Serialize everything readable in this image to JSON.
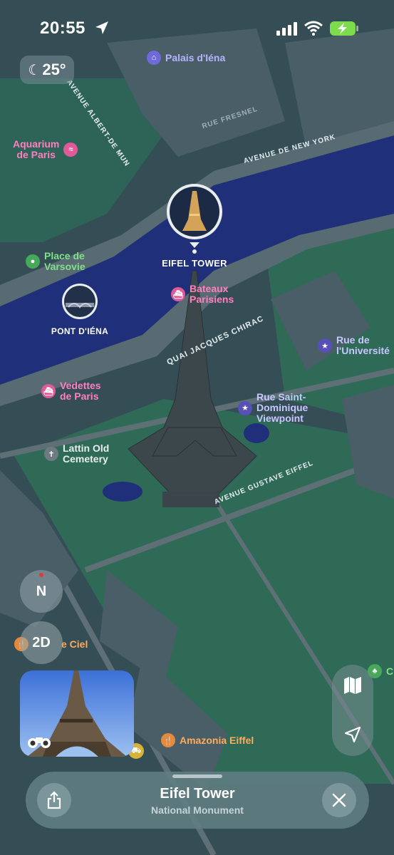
{
  "status_bar": {
    "time": "20:55",
    "location_icon": "location-arrow-icon",
    "signal_icon": "cellular-signal-icon",
    "wifi_icon": "wifi-icon",
    "battery_icon": "battery-charging-icon",
    "battery_color": "#7ddc4c"
  },
  "weather": {
    "temperature": "25°",
    "icon": "moon-stars-icon"
  },
  "streets": [
    {
      "label": "AVENUE ALBERT-DE MUN"
    },
    {
      "label": "AVENUE DE NEW YORK"
    },
    {
      "label": "RUE FRESNEL"
    },
    {
      "label": "QUAI JACQUES CHIRAC"
    },
    {
      "label": "AVENUE GUSTAVE EIFFEL"
    }
  ],
  "pois": {
    "palais": {
      "label": "Palais d'Iéna",
      "icon": "museum-icon"
    },
    "aquarium": {
      "label": "Aquarium de Paris",
      "line1": "Aquarium",
      "line2": "de Paris",
      "icon": "fish-icon"
    },
    "place_varsovie": {
      "line1": "Place de",
      "line2": "Varsovie",
      "icon": "park-icon"
    },
    "bateaux": {
      "line1": "Bateaux",
      "line2": "Parisiens",
      "icon": "ferry-icon"
    },
    "rue_universite": {
      "line1": "Rue de",
      "line2": "l'Université",
      "icon": "star-icon"
    },
    "vedettes": {
      "line1": "Vedettes",
      "line2": "de Paris",
      "icon": "ferry-icon"
    },
    "rue_saint_dominique": {
      "line1": "Rue Saint-",
      "line2": "Dominique",
      "line3": "Viewpoint",
      "icon": "star-icon"
    },
    "lattin": {
      "line1": "Lattin Old",
      "line2": "Cemetery",
      "icon": "cemetery-icon"
    },
    "ciel": {
      "label": "e Ciel",
      "icon": "restaurant-icon"
    },
    "amazonia": {
      "label": "Amazonia Eiffel",
      "icon": "restaurant-icon"
    },
    "edge_c": {
      "label": "C",
      "icon": "tree-icon"
    }
  },
  "pins": {
    "eiffel": {
      "label": "EIFEL TOWER"
    },
    "pont": {
      "label": "PONT D'IÉNA"
    }
  },
  "controls": {
    "compass": "N",
    "view_mode": "2D",
    "map_icon": "map-icon",
    "locate_icon": "location-arrow-icon",
    "look_around_icon": "binoculars-icon"
  },
  "sheet": {
    "title": "Eifel Tower",
    "subtitle": "National Monument",
    "share_icon": "share-icon",
    "close_icon": "close-icon"
  }
}
